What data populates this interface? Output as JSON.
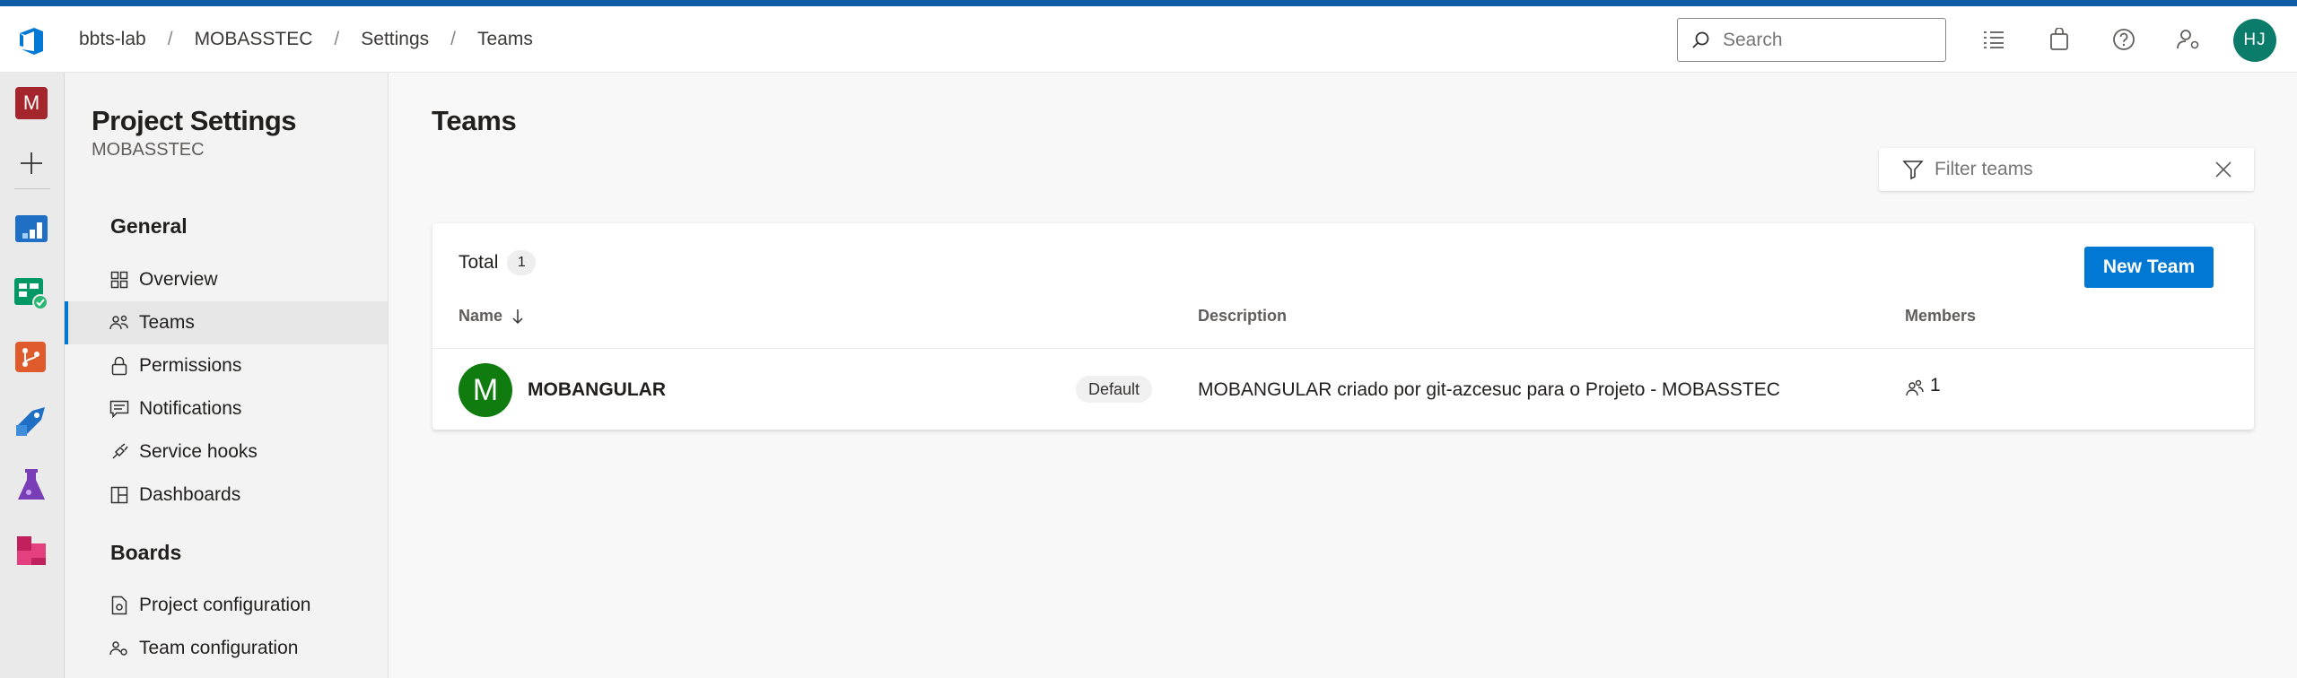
{
  "breadcrumb": [
    "bbts-lab",
    "MOBASSTEC",
    "Settings",
    "Teams"
  ],
  "header": {
    "search_placeholder": "Search",
    "user_initials": "HJ",
    "icons": [
      "search-icon",
      "work-items-icon",
      "marketplace-icon",
      "help-icon",
      "user-settings-icon"
    ]
  },
  "leftrail": {
    "project_initial": "M",
    "items": [
      "add-icon",
      "overview-icon",
      "boards-icon",
      "repos-icon",
      "pipelines-icon",
      "test-plans-icon",
      "artifacts-icon"
    ]
  },
  "sidebar": {
    "title": "Project Settings",
    "subtitle": "MOBASSTEC",
    "sections": [
      {
        "label": "General",
        "items": [
          {
            "label": "Overview",
            "icon": "overview-icon"
          },
          {
            "label": "Teams",
            "icon": "teams-icon",
            "selected": true
          },
          {
            "label": "Permissions",
            "icon": "lock-icon"
          },
          {
            "label": "Notifications",
            "icon": "notification-icon"
          },
          {
            "label": "Service hooks",
            "icon": "service-hooks-icon"
          },
          {
            "label": "Dashboards",
            "icon": "dashboard-icon"
          }
        ]
      },
      {
        "label": "Boards",
        "items": [
          {
            "label": "Project configuration",
            "icon": "project-config-icon"
          },
          {
            "label": "Team configuration",
            "icon": "team-config-icon"
          }
        ]
      }
    ]
  },
  "main": {
    "title": "Teams",
    "filter_placeholder": "Filter teams",
    "total_label": "Total",
    "total_count": "1",
    "new_team_label": "New Team",
    "columns": {
      "name": "Name",
      "description": "Description",
      "members": "Members"
    },
    "teams": [
      {
        "initial": "M",
        "name": "MOBANGULAR",
        "badge": "Default",
        "description": "MOBANGULAR criado por git-azcesuc para o Projeto - MOBASSTEC",
        "members": "1"
      }
    ]
  },
  "colors": {
    "accent": "#0078d4",
    "top_stripe": "#0f5ba7",
    "team_avatar": "#107c10",
    "user_avatar": "#0b7b6a",
    "project_badge": "#a4262c"
  }
}
